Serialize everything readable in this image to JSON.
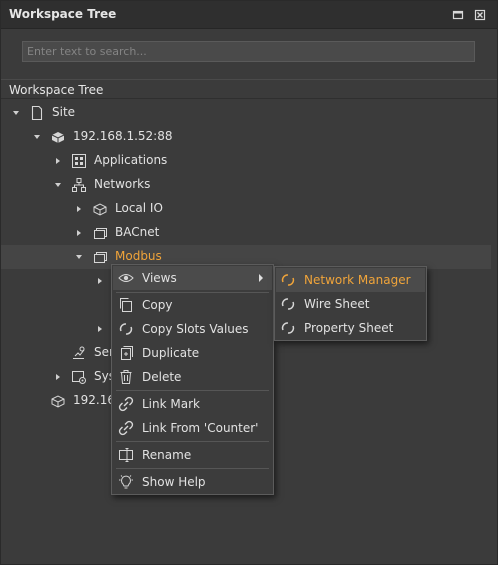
{
  "panel": {
    "title": "Workspace Tree",
    "search_placeholder": "Enter text to search...",
    "section_header": "Workspace Tree"
  },
  "tree": {
    "site": "Site",
    "station": "192.168.1.52:88",
    "applications": "Applications",
    "networks": "Networks",
    "local_io": "Local IO",
    "bacnet": "BACnet",
    "modbus": "Modbus",
    "services_partial": "Ser",
    "system_partial": "Sys",
    "station2_partial": "192.16"
  },
  "context_menu": {
    "views": "Views",
    "copy": "Copy",
    "copy_slots": "Copy Slots Values",
    "duplicate": "Duplicate",
    "delete": "Delete",
    "link_mark": "Link Mark",
    "link_from": "Link From 'Counter'",
    "rename": "Rename",
    "show_help": "Show Help"
  },
  "submenu": {
    "network_manager": "Network Manager",
    "wire_sheet": "Wire Sheet",
    "property_sheet": "Property Sheet"
  },
  "colors": {
    "accent": "#f0a43a",
    "background": "#3b3b3b"
  }
}
